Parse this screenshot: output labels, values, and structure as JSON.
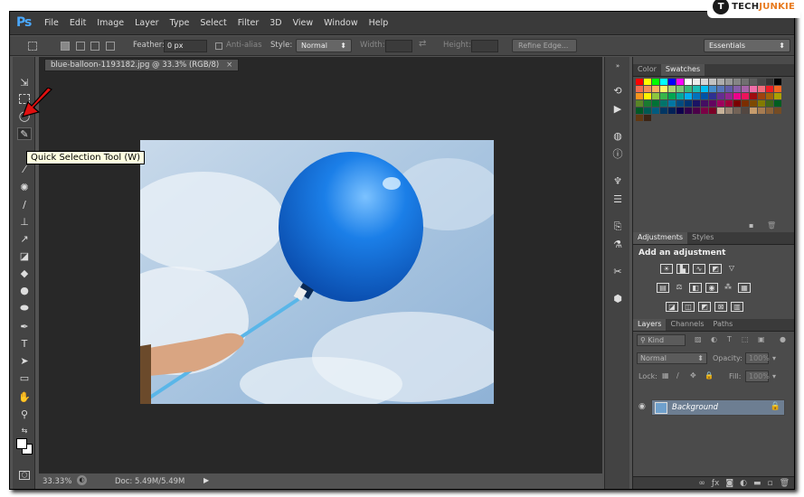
{
  "app": {
    "logo": "Ps"
  },
  "menu": [
    "File",
    "Edit",
    "Image",
    "Layer",
    "Type",
    "Select",
    "Filter",
    "3D",
    "View",
    "Window",
    "Help"
  ],
  "brand": {
    "mark": "T",
    "prefix": "TECH",
    "suffix": "JUNKIE"
  },
  "options": {
    "feather_label": "Feather:",
    "feather_value": "0 px",
    "antialias_label": "Anti-alias",
    "style_label": "Style:",
    "style_value": "Normal",
    "width_label": "Width:",
    "height_label": "Height:",
    "refine_label": "Refine Edge...",
    "workspace": "Essentials"
  },
  "tooltip": "Quick Selection Tool (W)",
  "document": {
    "tab_title": "blue-balloon-1193182.jpg @ 33.3% (RGB/8)",
    "close": "×"
  },
  "status": {
    "zoom": "33.33%",
    "doc": "Doc: 5.49M/5.49M"
  },
  "panels": {
    "color_tab": "Color",
    "swatches_tab": "Swatches",
    "adjustments_tab": "Adjustments",
    "styles_tab": "Styles",
    "add_adjustment": "Add an adjustment",
    "layers_tab": "Layers",
    "channels_tab": "Channels",
    "paths_tab": "Paths",
    "kind_label": "Kind",
    "blend_mode": "Normal",
    "opacity_label": "Opacity:",
    "opacity_value": "100%",
    "lock_label": "Lock:",
    "fill_label": "Fill:",
    "fill_value": "100%",
    "layer_name": "Background"
  },
  "colors": {
    "accent": "#4aa8ff",
    "balloon": "#1b7fe8",
    "sky": "#a9c5e0",
    "brand_orange": "#e87a1e",
    "arrow_red": "#e01010"
  },
  "swatch_colors": [
    "#ff0000",
    "#ffff00",
    "#00ff00",
    "#00ffff",
    "#0000ff",
    "#ff00ff",
    "#ffffff",
    "#ebebeb",
    "#d6d6d6",
    "#c2c2c2",
    "#adadad",
    "#999999",
    "#858585",
    "#707070",
    "#5c5c5c",
    "#474747",
    "#333333",
    "#000000",
    "#f26c4f",
    "#f68e56",
    "#fbaf5d",
    "#fff568",
    "#acd373",
    "#7cc576",
    "#3bb878",
    "#1abbb4",
    "#00bff3",
    "#438ccb",
    "#5574b9",
    "#605ca8",
    "#855fa8",
    "#a763a8",
    "#f06ea9",
    "#f26d7d",
    "#ed1c24",
    "#f26522",
    "#f7941d",
    "#fff200",
    "#8dc63f",
    "#39b54a",
    "#00a651",
    "#00a99d",
    "#00aeef",
    "#0072bc",
    "#0054a6",
    "#2e3192",
    "#662d91",
    "#92278f",
    "#ec008c",
    "#ed145b",
    "#9e0b0f",
    "#a0410d",
    "#a36209",
    "#aba000",
    "#598527",
    "#197b30",
    "#007236",
    "#00746b",
    "#0076a3",
    "#004b80",
    "#003471",
    "#1b1464",
    "#440e62",
    "#630460",
    "#9e005d",
    "#9e0039",
    "#790000",
    "#7b2e00",
    "#7d4900",
    "#827b00",
    "#406618",
    "#005e20",
    "#005826",
    "#005952",
    "#005b7f",
    "#003663",
    "#002157",
    "#0d004c",
    "#32004b",
    "#4b0049",
    "#7b0046",
    "#7a0026",
    "#c7b299",
    "#998675",
    "#736357",
    "#534741",
    "#c69c6d",
    "#a67c52",
    "#8c6239",
    "#754c24",
    "#603913",
    "#3c2415"
  ]
}
